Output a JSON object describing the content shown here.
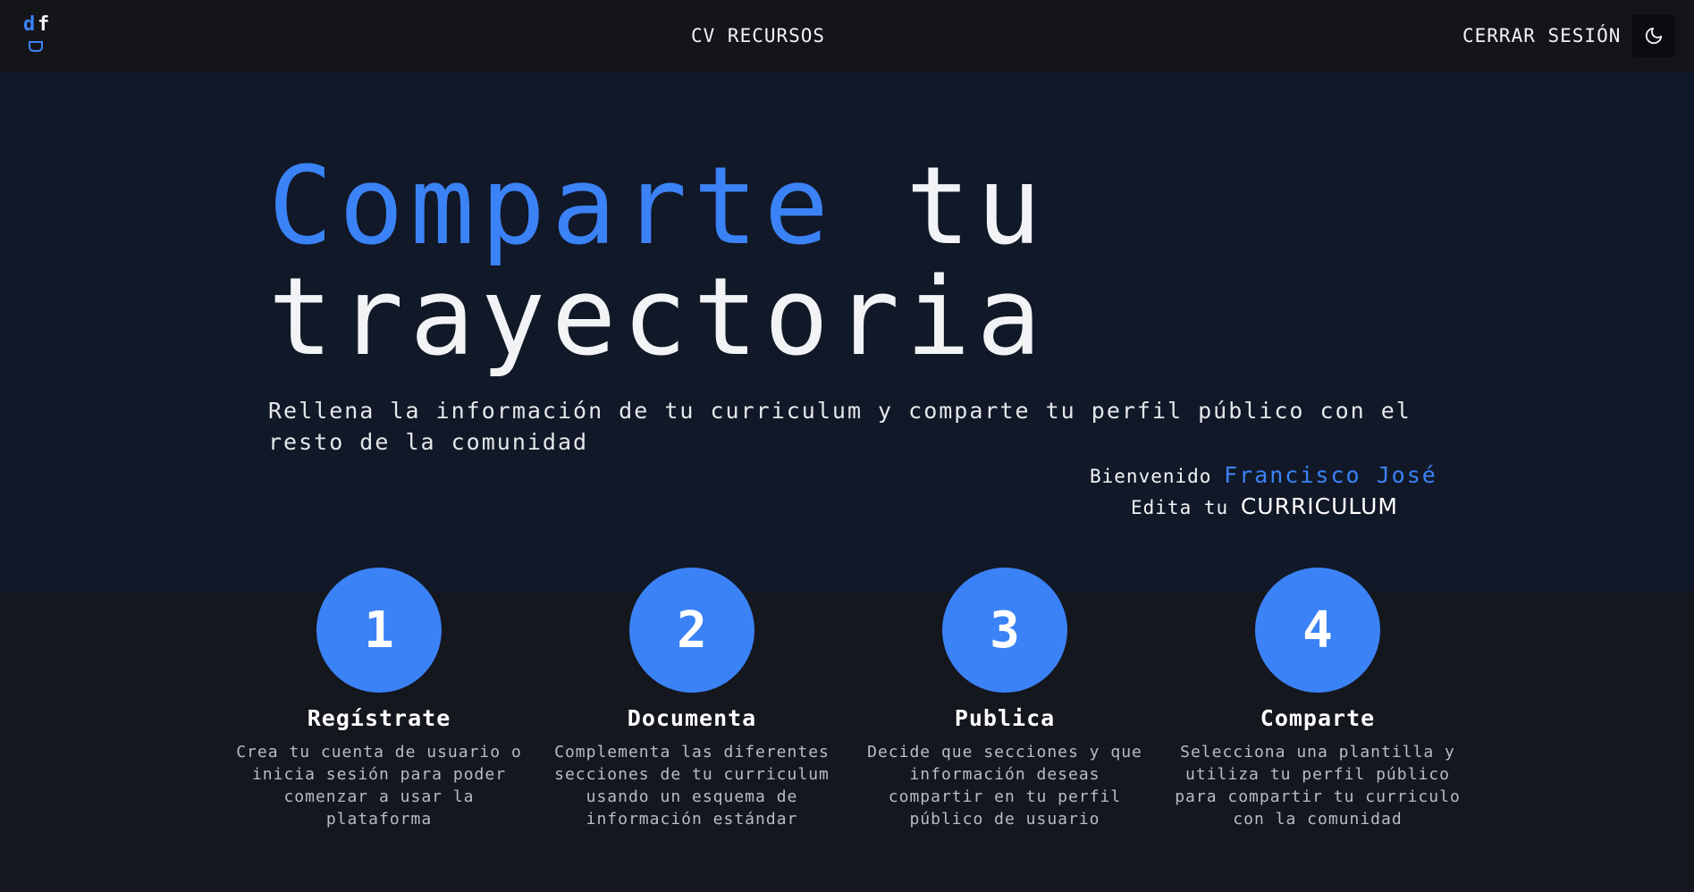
{
  "navbar": {
    "logo_d": "d",
    "logo_f": "f",
    "center_link": "CV RECURSOS",
    "logout_label": "CERRAR SESIÓN",
    "theme_icon": "moon-icon"
  },
  "hero": {
    "title_accent": "Comparte",
    "title_rest_1": " tu",
    "title_rest_2": "trayectoria",
    "subtitle": "Rellena la información de tu curriculum y comparte tu perfil público con el resto de la comunidad",
    "welcome_label": "Bienvenido",
    "user_name": "Francisco José",
    "edit_label": "Edita tu",
    "edit_link": "CURRICULUM"
  },
  "steps": [
    {
      "number": "1",
      "title": "Regístrate",
      "description": "Crea tu cuenta de usuario o inicia sesión para poder comenzar a usar la plataforma"
    },
    {
      "number": "2",
      "title": "Documenta",
      "description": "Complementa las diferentes secciones de tu curriculum usando un esquema de información estándar"
    },
    {
      "number": "3",
      "title": "Publica",
      "description": "Decide que secciones y que información deseas compartir en tu perfil público de usuario"
    },
    {
      "number": "4",
      "title": "Comparte",
      "description": "Selecciona una plantilla y utiliza tu perfil público para compartir tu curriculo con la comunidad"
    }
  ],
  "colors": {
    "accent": "#3b82f6",
    "hero_bg": "#111827",
    "page_bg": "#15171e",
    "nav_bg": "#141519"
  }
}
